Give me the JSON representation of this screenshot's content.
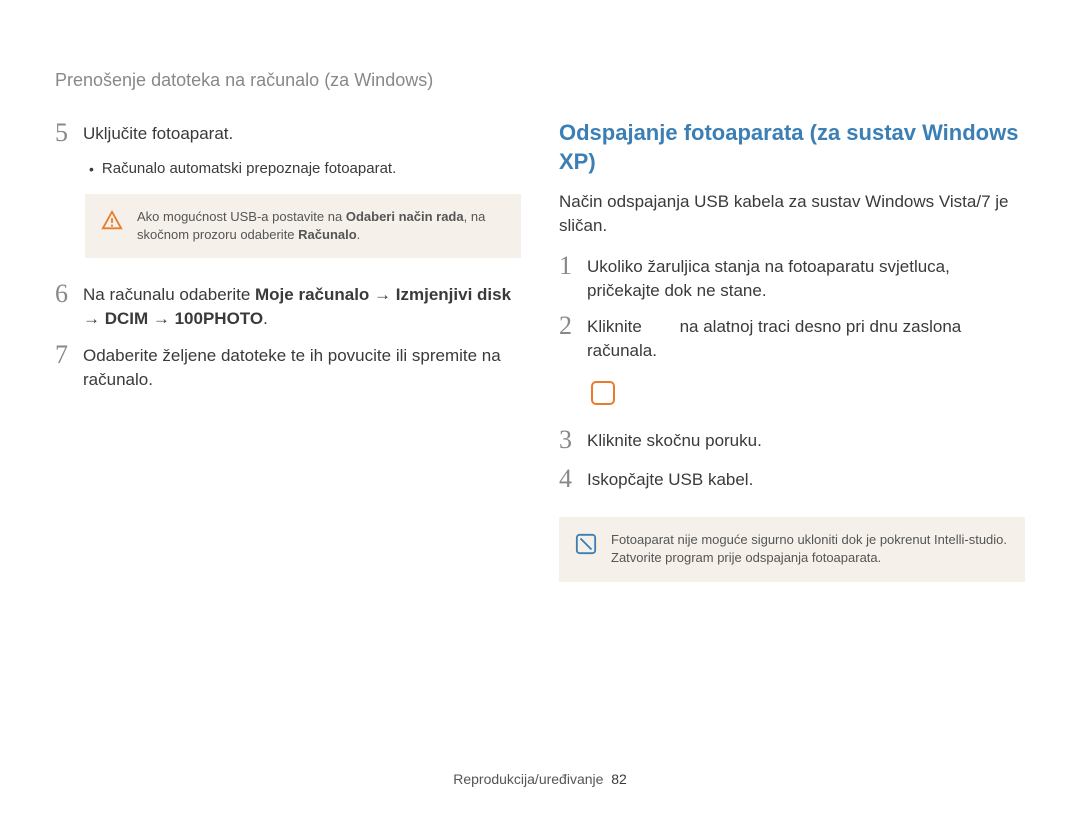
{
  "header": "Prenošenje datoteka na računalo (za Windows)",
  "left": {
    "step5": {
      "num": "5",
      "text": "Uključite fotoaparat."
    },
    "bullet5": "Računalo automatski prepoznaje fotoaparat.",
    "warn_note_pre": "Ako mogućnost USB-a postavite na ",
    "warn_note_bold1": "Odaberi način rada",
    "warn_note_mid": ", na skočnom prozoru odaberite ",
    "warn_note_bold2": "Računalo",
    "warn_note_post": ".",
    "step6": {
      "num": "6",
      "pre": "Na računalu odaberite ",
      "bold": "Moje računalo → Izmjenjivi disk → DCIM → 100PHOTO",
      "post": "."
    },
    "step7": {
      "num": "7",
      "text": "Odaberite željene datoteke te ih povucite ili spremite na računalo."
    }
  },
  "right": {
    "title": "Odspajanje fotoaparata (za sustav Windows XP)",
    "intro": "Način odspajanja USB kabela za sustav Windows Vista/7 je sličan.",
    "step1": {
      "num": "1",
      "text": "Ukoliko žaruljica stanja na fotoaparatu svjetluca, pričekajte dok ne stane."
    },
    "step2": {
      "num": "2",
      "pre": "Kliknite ",
      "post": " na alatnoj traci desno pri dnu zaslona računala."
    },
    "step3": {
      "num": "3",
      "text": "Kliknite skočnu poruku."
    },
    "step4": {
      "num": "4",
      "text": "Iskopčajte USB kabel."
    },
    "info_note": "Fotoaparat nije moguće sigurno ukloniti dok je pokrenut Intelli-studio. Zatvorite program prije odspajanja fotoaparata."
  },
  "footer": {
    "label": "Reprodukcija/uređivanje",
    "page": "82"
  }
}
